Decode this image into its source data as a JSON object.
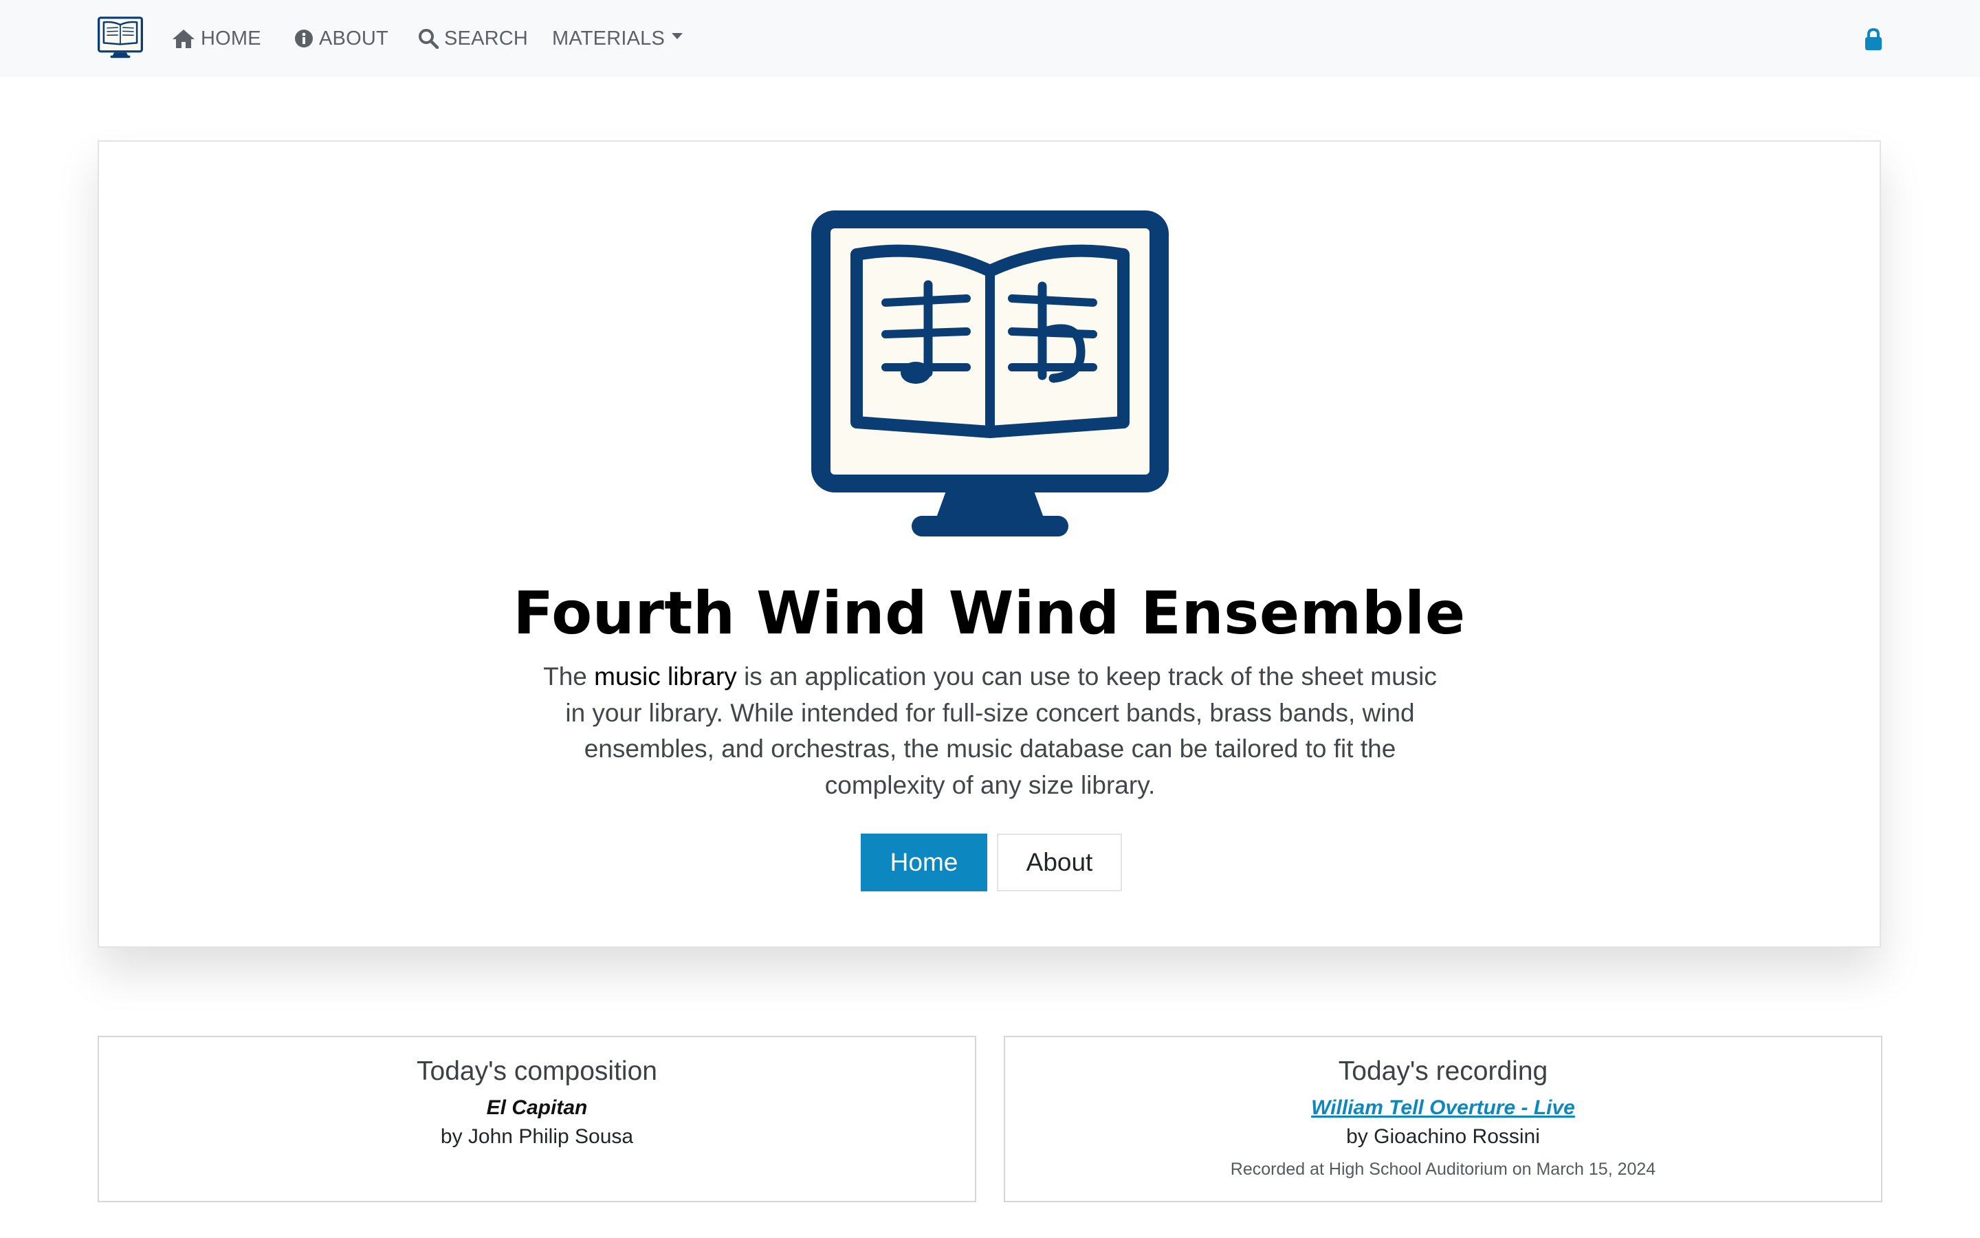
{
  "colors": {
    "brand_navy": "#0a3d73",
    "accent_blue": "#0d87bf",
    "page_cream": "#fdfaf2",
    "navbar_bg": "#f8f9fa"
  },
  "navbar": {
    "logo_icon": "music-monitor-logo-icon",
    "items": [
      {
        "icon": "home-icon",
        "label": "HOME"
      },
      {
        "icon": "info-circle-icon",
        "label": "ABOUT"
      },
      {
        "icon": "search-icon",
        "label": "SEARCH"
      },
      {
        "icon": "caret-down-icon",
        "label": "MATERIALS"
      }
    ],
    "login_icon": "lock-icon"
  },
  "hero": {
    "logo_icon": "music-monitor-logo-icon",
    "title": "Fourth Wind Wind Ensemble",
    "desc_prefix": "The ",
    "desc_highlight": "music library",
    "desc_rest": " is an application you can use to keep track of the sheet music in your library. While intended for full-size concert bands, brass bands, wind ensembles, and orchestras, the music database can be tailored to fit the complexity of any size library.",
    "buttons": {
      "home": "Home",
      "about": "About"
    }
  },
  "cards": {
    "composition": {
      "heading": "Today's composition",
      "title": "El Capitan",
      "by": "by John Philip Sousa"
    },
    "recording": {
      "heading": "Today's recording",
      "title": "William Tell Overture - Live",
      "by": "by Gioachino Rossini",
      "meta": "Recorded at High School Auditorium on March 15, 2024"
    }
  }
}
